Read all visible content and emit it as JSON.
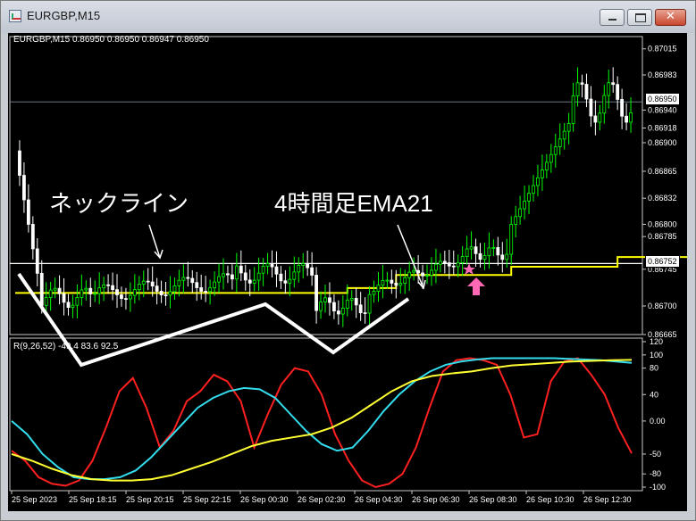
{
  "window": {
    "title": "EURGBP,M15",
    "controls": {
      "minimize": "minimize",
      "maximize": "maximize",
      "close": "close"
    }
  },
  "chart": {
    "symbol_info": "EURGBP,M15  0.86950 0.86950 0.86947 0.86950",
    "current_price": "0.86950",
    "neckline_price": "0.86752",
    "price_axis_labels": [
      "0.87015",
      "0.86983",
      "0.86950",
      "0.86940",
      "0.86918",
      "0.86900",
      "0.86865",
      "0.86832",
      "0.86800",
      "0.86785",
      "0.86745",
      "0.86700",
      "0.86665"
    ],
    "time_axis_labels": [
      "25 Sep 2023",
      "25 Sep 18:15",
      "25 Sep 20:15",
      "25 Sep 22:15",
      "26 Sep 00:30",
      "26 Sep 02:30",
      "26 Sep 04:30",
      "26 Sep 06:30",
      "26 Sep 08:30",
      "26 Sep 10:30",
      "26 Sep 12:30"
    ],
    "colors": {
      "background": "#000000",
      "bull": "#00FF00",
      "bear": "#FFFFFF",
      "ema": "#FFFF00",
      "drawing": "#FFFFFF",
      "signal": "#FF69B4"
    }
  },
  "annotations": {
    "neckline": "ネックライン",
    "ema": "4時間足EMA21"
  },
  "oscillator": {
    "info": "R(9,26,52) -49.4 83.6 92.5",
    "axis_labels": [
      "120",
      "100",
      "80",
      "40",
      "0.00",
      "-50",
      "-80",
      "-100"
    ],
    "colors": {
      "fast": "#FF2020",
      "mid": "#33DDEE",
      "slow": "#FFFF33"
    }
  },
  "chart_data": [
    {
      "type": "line",
      "title": "EURGBP,M15",
      "ylim": [
        0.86665,
        0.8703
      ],
      "series": [
        {
          "name": "EMA21",
          "values": [
            0.86716,
            0.86716,
            0.86716,
            0.86716,
            0.86716,
            0.86716,
            0.86716,
            0.86716,
            0.86716,
            0.86716,
            0.86716,
            0.86716,
            0.86716,
            0.86716,
            0.86716,
            0.86716,
            0.86716,
            0.86716,
            0.86716,
            0.86716,
            0.86716,
            0.86716,
            0.86716,
            0.86718,
            0.86718,
            0.86718,
            0.86718,
            0.86718,
            0.86718,
            0.86718,
            0.86718,
            0.86718,
            0.86718,
            0.86718,
            0.86718,
            0.8672,
            0.8672,
            0.8672,
            0.8672,
            0.8672,
            0.8672,
            0.8672,
            0.8672,
            0.8672,
            0.8672,
            0.8672,
            0.8672,
            0.86722,
            0.86722,
            0.86722,
            0.86722,
            0.86722,
            0.86722,
            0.86722,
            0.86722,
            0.86722,
            0.86722,
            0.86722,
            0.86722,
            0.86722,
            0.86722,
            0.86722,
            0.86722,
            0.86722,
            0.86722,
            0.86722,
            0.86722,
            0.86722,
            0.86722,
            0.86722,
            0.86722,
            0.86722,
            0.86722,
            0.86722,
            0.86722,
            0.86722,
            0.86722,
            0.86722,
            0.86722,
            0.86722,
            0.86722,
            0.86722,
            0.86722,
            0.86722,
            0.86722,
            0.86722,
            0.86722,
            0.86722,
            0.86722,
            0.86722,
            0.86722,
            0.86722,
            0.86722,
            0.86722,
            0.86722,
            0.86722,
            0.86722,
            0.86722,
            0.86722,
            0.86722,
            0.86722,
            0.86722,
            0.86722,
            0.86722,
            0.86722,
            0.86722,
            0.86722,
            0.86722,
            0.86722,
            0.86722,
            0.86722,
            0.86722,
            0.86722,
            0.86722,
            0.86722,
            0.86722,
            0.86722,
            0.86722,
            0.86722,
            0.86722,
            0.86722,
            0.86722,
            0.86722,
            0.86722,
            0.86722,
            0.86722,
            0.86722,
            0.86722,
            0.86722,
            0.86722,
            0.86722,
            0.86722,
            0.86722,
            0.86722,
            0.86722,
            0.86722,
            0.86722,
            0.86722,
            0.86722,
            0.86722,
            0.86722,
            0.86722
          ]
        }
      ],
      "ema_steps": [
        {
          "from": 0,
          "to": 75,
          "value": 0.86716
        },
        {
          "from": 75,
          "to": 86,
          "value": 0.86722
        },
        {
          "from": 86,
          "to": 112,
          "value": 0.86738
        },
        {
          "from": 112,
          "to": 136,
          "value": 0.86748
        },
        {
          "from": 136,
          "to": 152,
          "value": 0.8676
        }
      ],
      "neckline": 0.86752,
      "candles_note": "synthetic-shape"
    },
    {
      "type": "line",
      "title": "R(9,26,52)",
      "ylim": [
        -100,
        120
      ],
      "series": [
        {
          "name": "R(9)",
          "values": [
            -45,
            -60,
            -85,
            -95,
            -98,
            -90,
            -60,
            -10,
            45,
            65,
            20,
            -40,
            -15,
            30,
            45,
            70,
            60,
            30,
            -40,
            10,
            55,
            80,
            75,
            40,
            -20,
            -60,
            -90,
            -100,
            -95,
            -80,
            -40,
            20,
            75,
            92,
            95,
            92,
            85,
            40,
            -25,
            -20,
            60,
            90,
            95,
            70,
            40,
            -10,
            -49
          ]
        },
        {
          "name": "R(26)",
          "values": [
            0,
            -20,
            -50,
            -70,
            -85,
            -88,
            -88,
            -85,
            -75,
            -55,
            -30,
            -5,
            20,
            35,
            45,
            50,
            48,
            35,
            10,
            -15,
            -35,
            -45,
            -40,
            -15,
            15,
            40,
            60,
            75,
            85,
            90,
            93,
            95,
            95,
            95,
            95,
            95,
            94,
            93,
            92,
            90,
            88
          ]
        },
        {
          "name": "R(52)",
          "values": [
            -50,
            -60,
            -72,
            -82,
            -88,
            -90,
            -90,
            -88,
            -82,
            -72,
            -62,
            -50,
            -38,
            -30,
            -25,
            -20,
            -10,
            5,
            25,
            45,
            60,
            68,
            72,
            75,
            80,
            84,
            86,
            88,
            90,
            91,
            92,
            92.5
          ]
        }
      ]
    }
  ]
}
